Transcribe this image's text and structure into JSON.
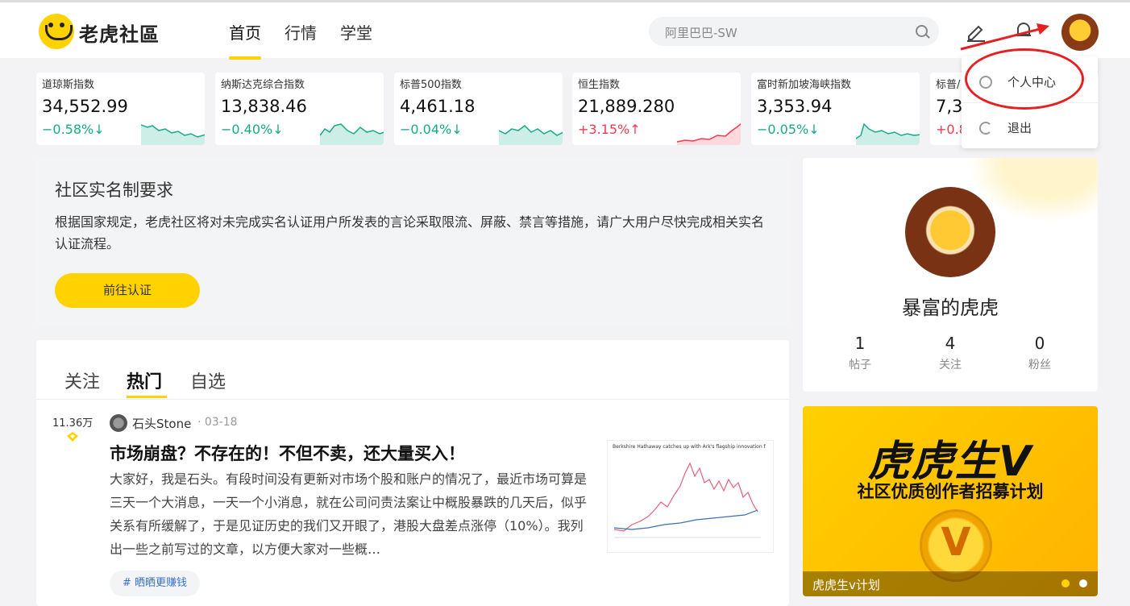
{
  "header": {
    "brand": "老虎社區",
    "nav": [
      "首页",
      "行情",
      "学堂"
    ],
    "search_placeholder": "阿里巴巴-SW"
  },
  "dropdown": {
    "items": [
      {
        "label": "个人中心",
        "icon": "user-icon"
      },
      {
        "label": "退出",
        "icon": "logout-icon"
      }
    ]
  },
  "indices": [
    {
      "name": "道琼斯指数",
      "price": "34,552.99",
      "change": "−0.58%",
      "dir": "down"
    },
    {
      "name": "纳斯达克综合指数",
      "price": "13,838.46",
      "change": "−0.40%",
      "dir": "down"
    },
    {
      "name": "标普500指数",
      "price": "4,461.18",
      "change": "−0.04%",
      "dir": "down"
    },
    {
      "name": "恒生指数",
      "price": "21,889.280",
      "change": "+3.15%",
      "dir": "up"
    },
    {
      "name": "富时新加坡海峡指数",
      "price": "3,353.94",
      "change": "−0.05%",
      "dir": "down"
    },
    {
      "name": "标普/",
      "price": "7,3",
      "change": "+0.8",
      "dir": "up"
    }
  ],
  "notice": {
    "title": "社区实名制要求",
    "desc": "根据国家规定，老虎社区将对未完成实名认证用户所发表的言论采取限流、屏蔽、禁言等措施，请广大用户尽快完成相关实名认证流程。",
    "button": "前往认证"
  },
  "feed": {
    "tabs": [
      "关注",
      "热门",
      "自选"
    ],
    "post": {
      "views": "11.36万",
      "author": "石头Stone",
      "date": "· 03-18",
      "title": "市场崩盘？不存在的！不但不卖，还大量买入！",
      "body": "大家好，我是石头。有段时间没有更新对市场个股和账户的情况了，最近市场可算是三天一个大消息，一天一个小消息，就在公司问责法案让中概股暴跌的几天后，似乎关系有所缓解了，于是见证历史的我们又开眼了，港股大盘差点涨停（10%）。我列出一些之前写过的文章，以方便大家对一些概…",
      "tag": "# 晒晒更赚钱",
      "thumb_caption": "Berkshire Hathaway catches up with Ark's flagship innovation fund"
    }
  },
  "profile": {
    "name": "暴富的虎虎",
    "stats": [
      {
        "n": "1",
        "l": "帖子"
      },
      {
        "n": "4",
        "l": "关注"
      },
      {
        "n": "0",
        "l": "粉丝"
      }
    ]
  },
  "banner": {
    "title": "虎虎生V",
    "subtitle": "社区优质创作者招募计划",
    "coin": "V",
    "caption": "虎虎生v计划"
  },
  "colors": {
    "accent": "#ffd200",
    "down": "#18a98a",
    "up": "#ee3a52",
    "annotation": "#e62020"
  }
}
